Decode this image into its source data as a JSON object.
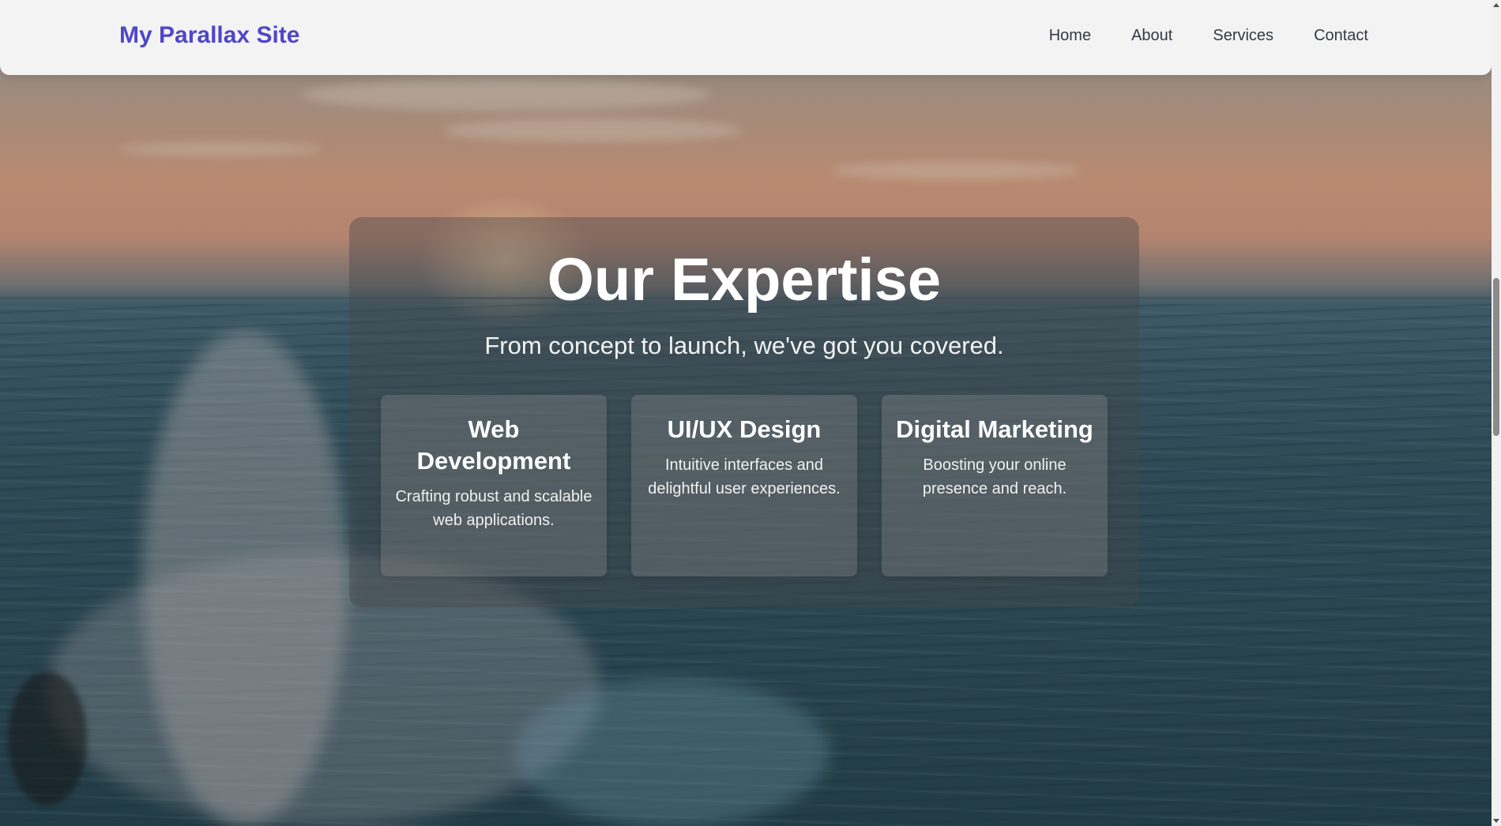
{
  "navbar": {
    "brand": "My Parallax Site",
    "links": [
      {
        "label": "Home"
      },
      {
        "label": "About"
      },
      {
        "label": "Services"
      },
      {
        "label": "Contact"
      }
    ]
  },
  "hero": {
    "title": "Our Expertise",
    "subtitle": "From concept to launch, we've got you covered.",
    "cards": [
      {
        "title": "Web Development",
        "description": "Crafting robust and scalable web applications."
      },
      {
        "title": "UI/UX Design",
        "description": "Intuitive interfaces and delightful user experiences."
      },
      {
        "title": "Digital Marketing",
        "description": "Boosting your online presence and reach."
      }
    ]
  },
  "colors": {
    "brand": "#4f46c9",
    "nav_text": "#333a44",
    "navbar_bg": "#f7f7f7"
  },
  "icons": [
    "scroll-up-arrow-icon",
    "scroll-down-arrow-icon"
  ]
}
